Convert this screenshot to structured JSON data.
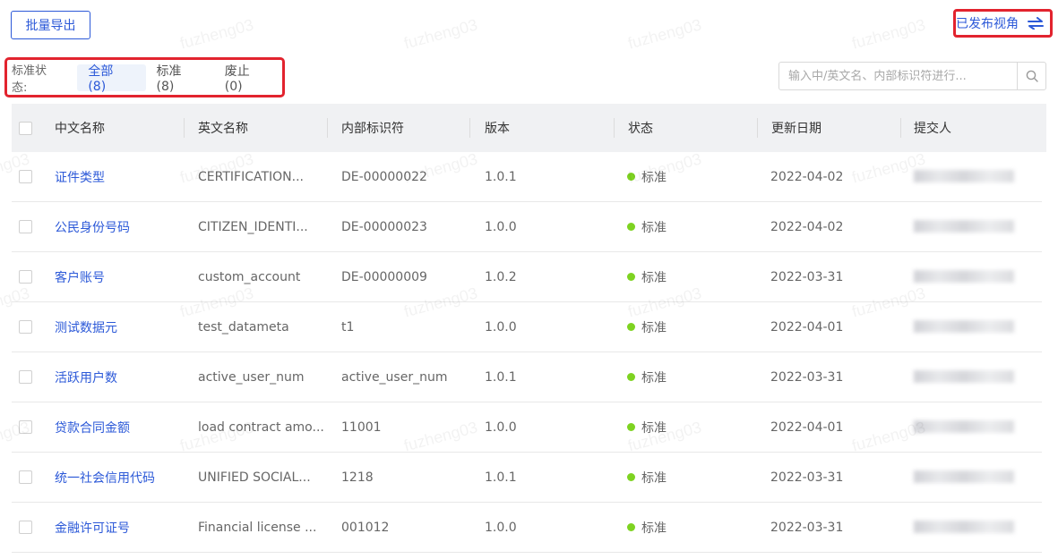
{
  "toolbar": {
    "export_label": "批量导出",
    "view_toggle_label": "已发布视角"
  },
  "status_filter": {
    "label": "标准状态:",
    "options": [
      {
        "label": "全部 (8)",
        "active": true
      },
      {
        "label": "标准 (8)",
        "active": false
      },
      {
        "label": "废止 (0)",
        "active": false
      }
    ]
  },
  "search": {
    "placeholder": "输入中/英文名、内部标识符进行...",
    "value": ""
  },
  "table": {
    "columns": [
      "中文名称",
      "英文名称",
      "内部标识符",
      "版本",
      "状态",
      "更新日期",
      "提交人"
    ],
    "rows": [
      {
        "cn": "证件类型",
        "en": "CERTIFICATION...",
        "id": "DE-00000022",
        "version": "1.0.1",
        "status": "标准",
        "date": "2022-04-02"
      },
      {
        "cn": "公民身份号码",
        "en": "CITIZEN_IDENTI...",
        "id": "DE-00000023",
        "version": "1.0.0",
        "status": "标准",
        "date": "2022-04-02"
      },
      {
        "cn": "客户账号",
        "en": "custom_account",
        "id": "DE-00000009",
        "version": "1.0.2",
        "status": "标准",
        "date": "2022-03-31"
      },
      {
        "cn": "测试数据元",
        "en": "test_datameta",
        "id": "t1",
        "version": "1.0.0",
        "status": "标准",
        "date": "2022-04-01"
      },
      {
        "cn": "活跃用户数",
        "en": "active_user_num",
        "id": "active_user_num",
        "version": "1.0.1",
        "status": "标准",
        "date": "2022-03-31"
      },
      {
        "cn": "贷款合同金额",
        "en": "load contract amo...",
        "id": "11001",
        "version": "1.0.0",
        "status": "标准",
        "date": "2022-04-01"
      },
      {
        "cn": "统一社会信用代码",
        "en": "UNIFIED SOCIAL...",
        "id": "1218",
        "version": "1.0.1",
        "status": "标准",
        "date": "2022-03-31"
      },
      {
        "cn": "金融许可证号",
        "en": "Financial license ...",
        "id": "001012",
        "version": "1.0.0",
        "status": "标准",
        "date": "2022-03-31"
      }
    ]
  },
  "watermark": {
    "text": "fuzheng03"
  },
  "colors": {
    "accent": "#2c59d8",
    "highlight": "#e2232e",
    "status_ok": "#7ed321"
  }
}
